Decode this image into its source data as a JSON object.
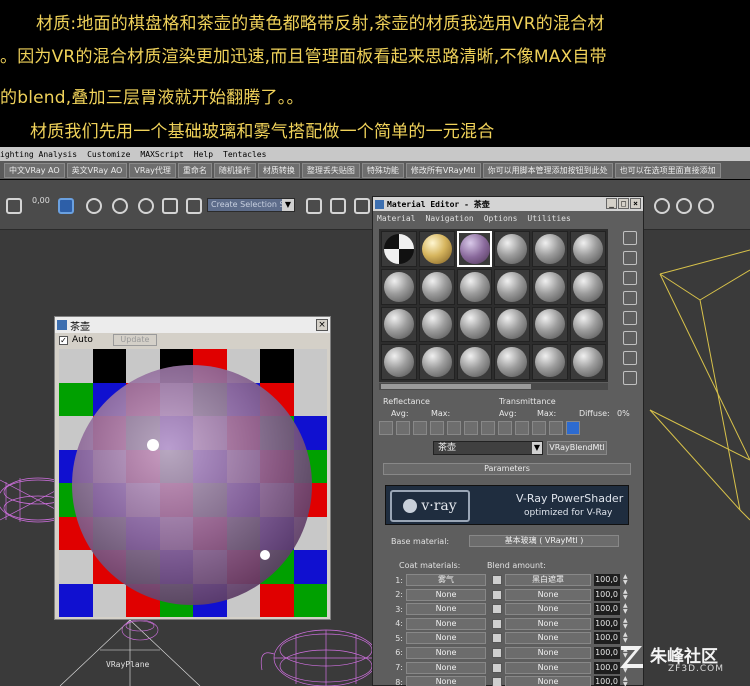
{
  "tutorial": {
    "line1": "材质:地面的棋盘格和茶壶的黄色都略带反射,茶壶的材质我选用VR的混合材",
    "line2": "。因为VR的混合材质渲染更加迅速,而且管理面板看起来思路清晰,不像MAX自带",
    "line3": "的blend,叠加三层胃液就开始翻腾了。。",
    "line4": "材质我们先用一个基础玻璃和雾气搭配做一个简单的一元混合"
  },
  "menubar": [
    "ighting Analysis",
    "Customize",
    "MAXScript",
    "Help",
    "Tentacles"
  ],
  "tabs": [
    "中文VRay AO",
    "英文VRay AO",
    "VRay代理",
    "重命名",
    "随机操作",
    "材质转换",
    "整理丢失贴图",
    "特殊功能",
    "修改所有VRayMtl",
    "你可以用脚本管理添加按钮到此处",
    "也可以在选项里面直接添加"
  ],
  "toolbar": {
    "spinner_value": "0,00",
    "selection_set_placeholder": "Create Selection Se"
  },
  "preview": {
    "title": "茶壶",
    "auto_label": "Auto",
    "update_label": "Update",
    "close_label": "×",
    "checker_colors": [
      "#e00000",
      "#00a000",
      "#1010d0",
      "#c8c8c8",
      "#000000"
    ]
  },
  "material_editor": {
    "title": "Material Editor - 茶壶",
    "menu": [
      "Material",
      "Navigation",
      "Options",
      "Utilities"
    ],
    "reflectance_label": "Reflectance",
    "transmittance_label": "Transmittance",
    "avg_label": "Avg:",
    "max_label": "Max:",
    "diffuse_label": "Diffuse:",
    "diffuse_value": "0%",
    "material_name": "茶壶",
    "material_type": "VRayBlendMtl",
    "parameters_label": "Parameters",
    "banner_title": "V-Ray PowerShader",
    "banner_subtitle": "optimized for V-Ray",
    "vray_logo_text": "v·ray",
    "base_material_label": "Base material:",
    "base_material_value": "基本玻璃 ( VRayMtl )",
    "coat_materials_label": "Coat materials:",
    "blend_amount_label": "Blend amount:",
    "coats": [
      {
        "index": "1:",
        "coat": "雾气",
        "blend": "黑白遮罩",
        "amount": "100,0"
      },
      {
        "index": "2:",
        "coat": "None",
        "blend": "None",
        "amount": "100,0"
      },
      {
        "index": "3:",
        "coat": "None",
        "blend": "None",
        "amount": "100,0"
      },
      {
        "index": "4:",
        "coat": "None",
        "blend": "None",
        "amount": "100,0"
      },
      {
        "index": "5:",
        "coat": "None",
        "blend": "None",
        "amount": "100,0"
      },
      {
        "index": "6:",
        "coat": "None",
        "blend": "None",
        "amount": "100,0"
      },
      {
        "index": "7:",
        "coat": "None",
        "blend": "None",
        "amount": "100,0"
      },
      {
        "index": "8:",
        "coat": "None",
        "blend": "None",
        "amount": "100,0"
      }
    ]
  },
  "viewport": {
    "object_label": "VRayPlane"
  },
  "watermark": {
    "cn": "朱峰社区",
    "en": "ZF3D.COM"
  }
}
